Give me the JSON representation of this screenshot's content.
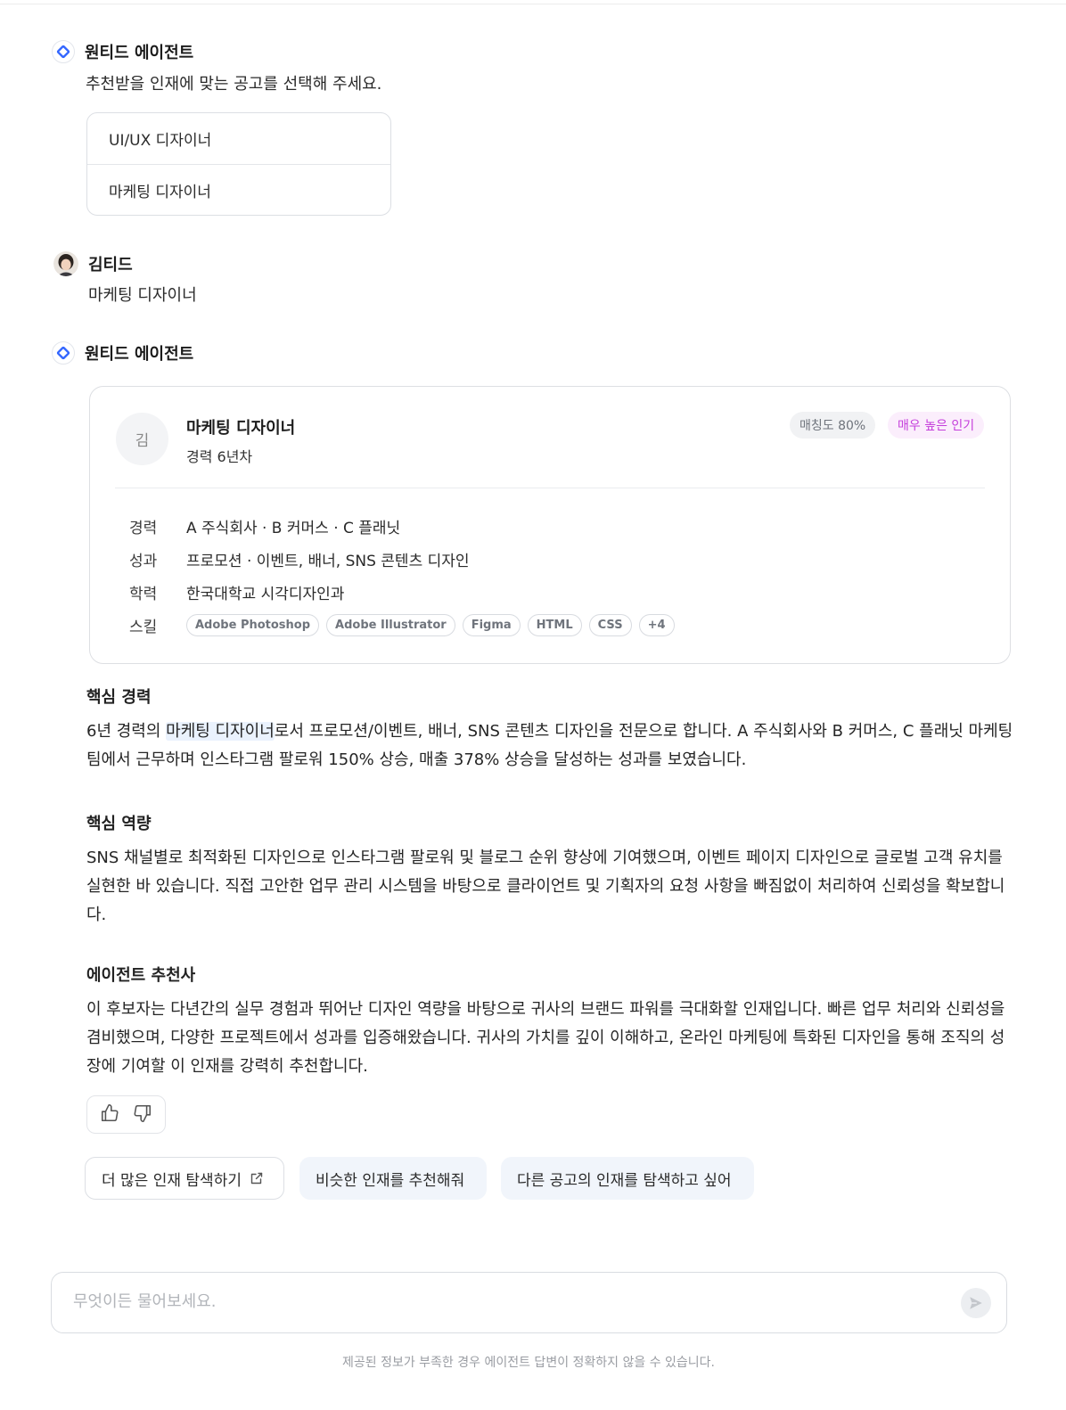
{
  "agent": {
    "name": "원티드 에이전트",
    "prompt": "추천받을 인재에 맞는 공고를 선택해 주세요.",
    "choices": [
      "UI/UX 디자이너",
      "마케팅 디자이너"
    ]
  },
  "user": {
    "name": "김티드",
    "message": "마케팅 디자이너"
  },
  "agent2": {
    "name": "원티드 에이전트"
  },
  "candidate": {
    "avatar_initial": "김",
    "title": "마케팅 디자이너",
    "experience_years": "경력 6년차",
    "match_badge": "매칭도 80%",
    "popularity_badge": "매우 높은 인기",
    "rows": {
      "career_label": "경력",
      "career_value": "A 주식회사 · B 커머스 · C 플래닛",
      "achievement_label": "성과",
      "achievement_value": "프로모션 · 이벤트, 배너, SNS 콘텐츠 디자인",
      "education_label": "학력",
      "education_value": "한국대학교 시각디자인과",
      "skills_label": "스킬"
    },
    "skills": [
      "Adobe Photoshop",
      "Adobe Illustrator",
      "Figma",
      "HTML",
      "CSS",
      "+4"
    ]
  },
  "sections": {
    "career": {
      "title": "핵심 경력",
      "body_prefix": "6년 경력의 ",
      "body_highlight": "마케팅 디자이너",
      "body_suffix": "로서 프로모션/이벤트, 배너, SNS 콘텐츠 디자인을 전문으로 합니다. A 주식회사와 B 커머스, C 플래닛 마케팅팀에서 근무하며 인스타그램 팔로워 150% 상승, 매출 378% 상승을 달성하는 성과를 보였습니다."
    },
    "competency": {
      "title": "핵심 역량",
      "body": "SNS 채널별로 최적화된 디자인으로 인스타그램 팔로워 및 블로그 순위 향상에 기여했으며, 이벤트 페이지 디자인으로 글로벌 고객 유치를 실현한 바 있습니다. 직접 고안한 업무 관리 시스템을 바탕으로 클라이언트 및 기획자의 요청 사항을 빠짐없이 처리하여 신뢰성을 확보합니다."
    },
    "recommendation": {
      "title": "에이전트 추천사",
      "body": "이 후보자는 다년간의 실무 경험과 뛰어난 디자인 역량을 바탕으로 귀사의 브랜드 파워를 극대화할 인재입니다. 빠른 업무 처리와 신뢰성을 겸비했으며, 다양한 프로젝트에서 성과를 입증해왔습니다. 귀사의 가치를 깊이 이해하고, 온라인 마케팅에 특화된 디자인을 통해 조직의 성장에 기여할 이 인재를 강력히 추천합니다."
    }
  },
  "suggestions": [
    "더 많은 인재 탐색하기",
    "비슷한 인재를 추천해줘",
    "다른 공고의 인재를 탐색하고 싶어"
  ],
  "input": {
    "placeholder": "무엇이든 물어보세요."
  },
  "disclaimer": "제공된 정보가 부족한 경우 에이전트 답변이 정확하지 않을 수 있습니다.",
  "colors": {
    "brand": "#3366ff",
    "popularity": "#c53edb",
    "suggestion_bg": "#f1f5fb"
  },
  "icons": [
    "agent-logo-icon",
    "thumbs-up-icon",
    "thumbs-down-icon",
    "external-link-icon",
    "send-icon"
  ]
}
